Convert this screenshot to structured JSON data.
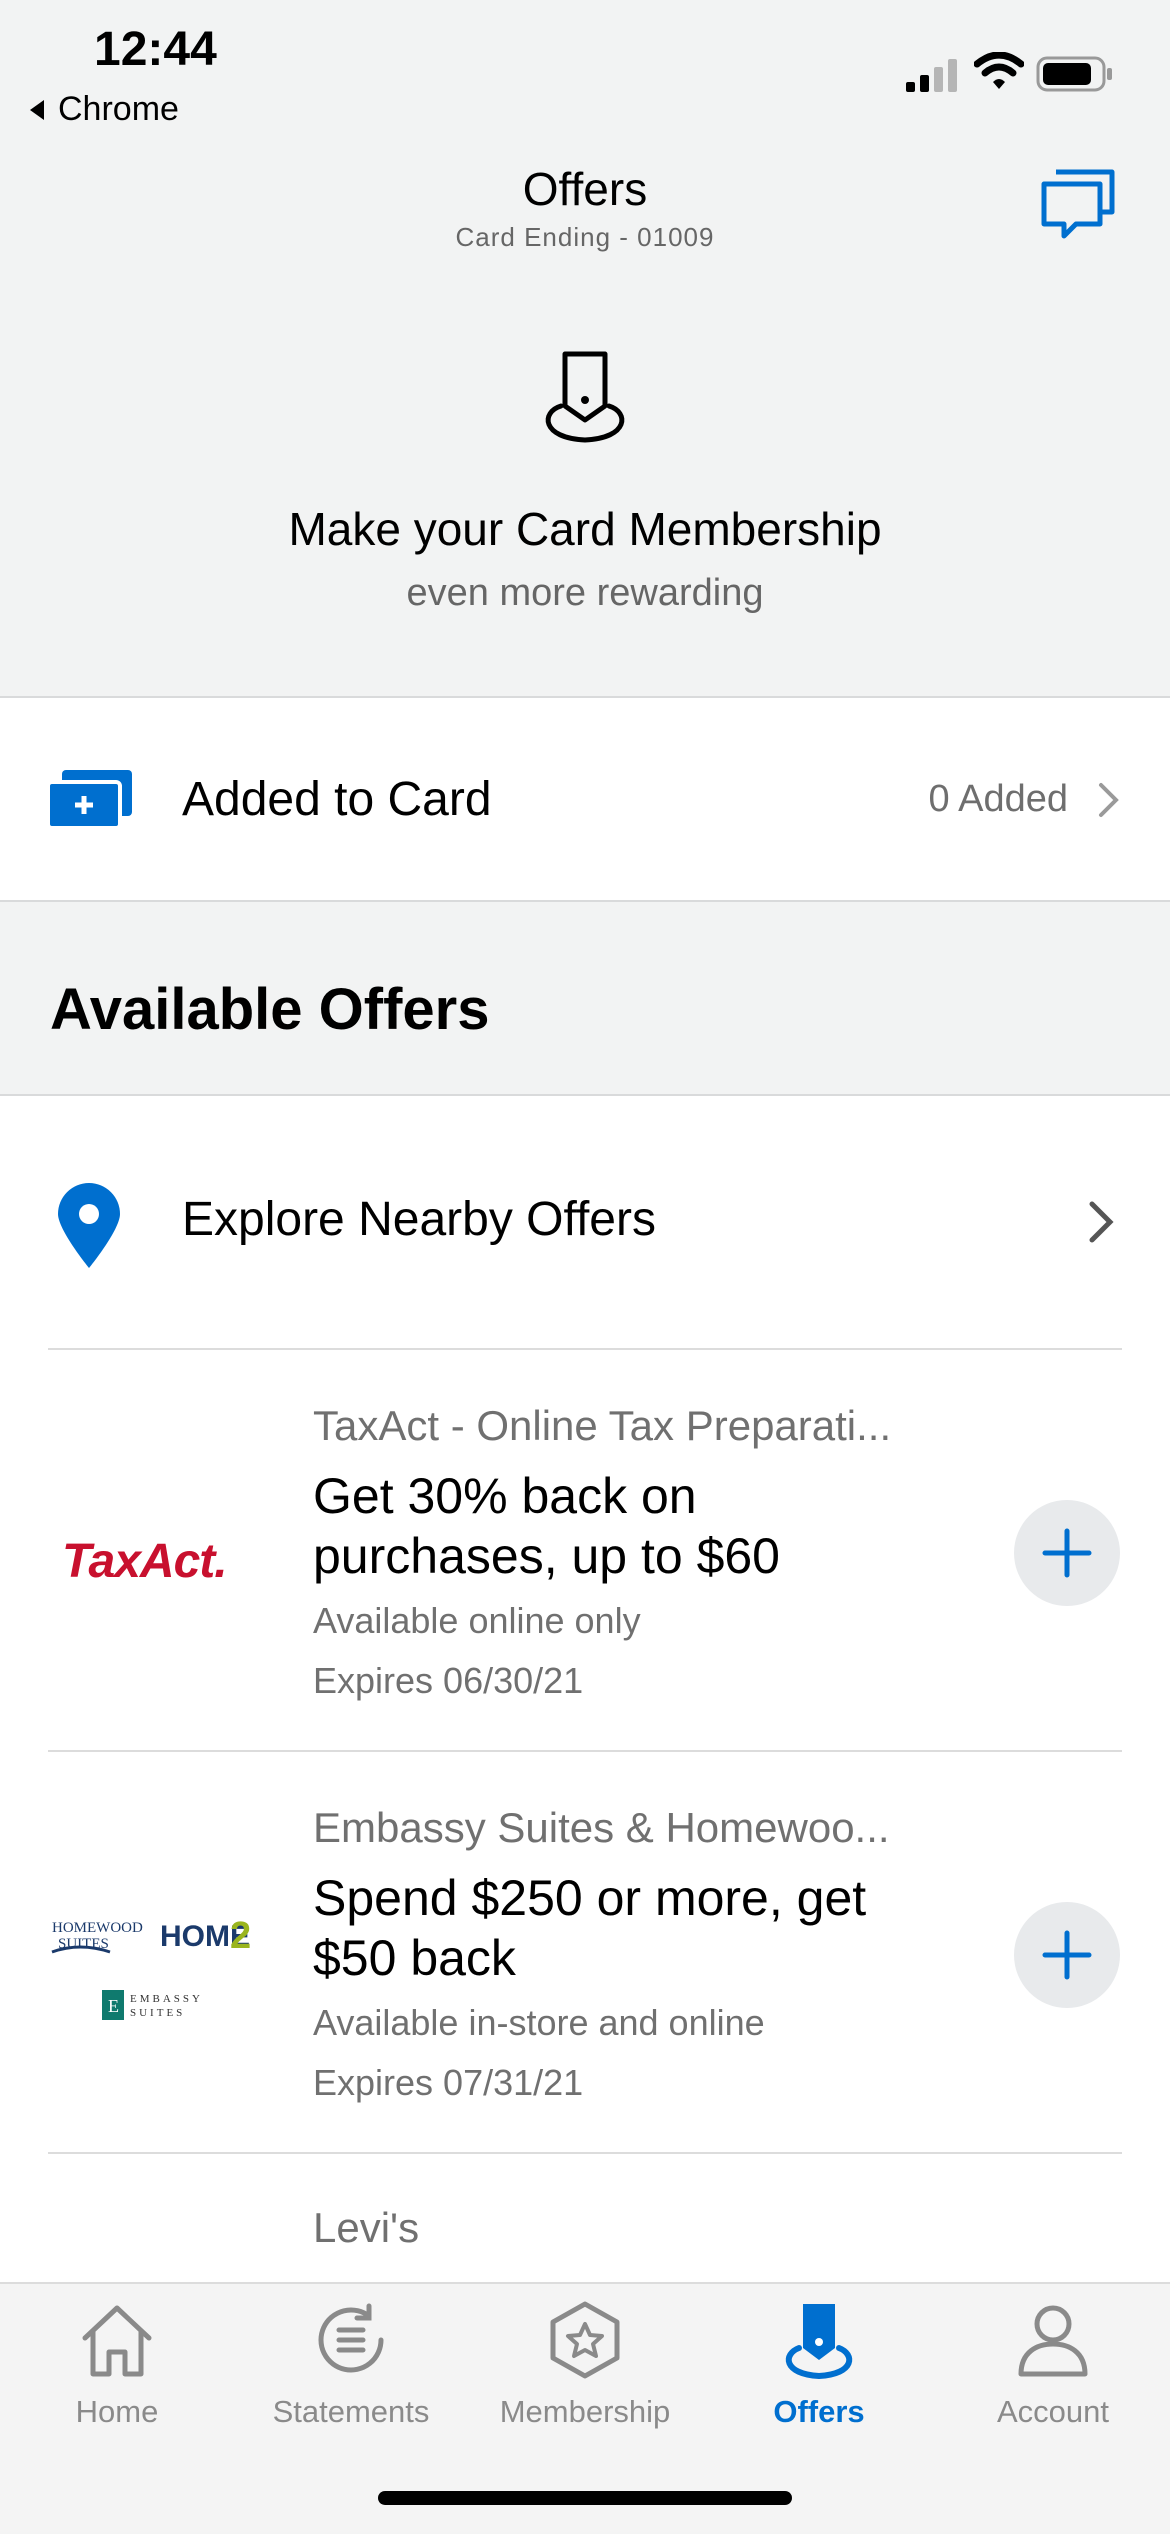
{
  "status_bar": {
    "time": "12:44",
    "back_app": "Chrome"
  },
  "header": {
    "title": "Offers",
    "subtitle": "Card Ending - 01009"
  },
  "hero": {
    "title": "Make your Card Membership",
    "subtitle": "even more rewarding"
  },
  "added_to_card": {
    "label": "Added to Card",
    "count": "0 Added"
  },
  "available_offers": {
    "heading": "Available Offers",
    "nearby_label": "Explore Nearby Offers",
    "offers": [
      {
        "logo_text": "TaxAct.",
        "merchant": "TaxAct - Online Tax Preparati...",
        "headline": "Get 30% back on purchases, up to $60",
        "channel": "Available online only",
        "expires": "Expires 06/30/21"
      },
      {
        "logo_text": "HOMEWOOD SUITES · HOME2 · EMBASSY SUITES",
        "merchant": "Embassy Suites & Homewoo...",
        "headline": "Spend $250 or more, get $50 back",
        "channel": "Available in-store and online",
        "expires": "Expires 07/31/21"
      },
      {
        "merchant": "Levi's"
      }
    ]
  },
  "tabbar": {
    "tabs": [
      {
        "label": "Home",
        "icon": "house-icon",
        "active": false
      },
      {
        "label": "Statements",
        "icon": "statement-icon",
        "active": false
      },
      {
        "label": "Membership",
        "icon": "star-badge-icon",
        "active": false
      },
      {
        "label": "Offers",
        "icon": "offers-tag-icon",
        "active": true
      },
      {
        "label": "Account",
        "icon": "person-icon",
        "active": false
      }
    ]
  },
  "colors": {
    "accent": "#006fcf",
    "taxact_red": "#c8102e",
    "background_grey": "#f2f3f3"
  }
}
